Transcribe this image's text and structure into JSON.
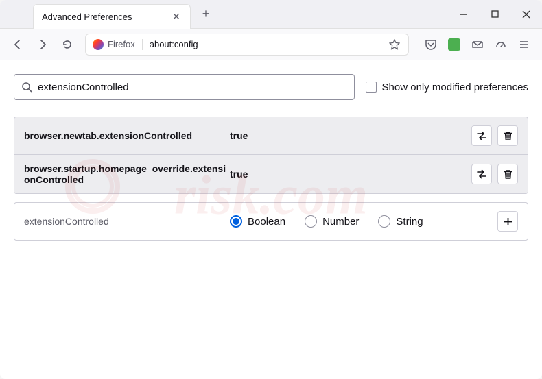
{
  "window": {
    "tab_title": "Advanced Preferences"
  },
  "urlbar": {
    "identity_label": "Firefox",
    "url": "about:config"
  },
  "search": {
    "value": "extensionControlled",
    "checkbox_label": "Show only modified preferences"
  },
  "prefs": [
    {
      "name": "browser.newtab.extensionControlled",
      "value": "true"
    },
    {
      "name": "browser.startup.homepage_override.extensionControlled",
      "value": "true"
    }
  ],
  "new_pref": {
    "name": "extensionControlled",
    "types": [
      "Boolean",
      "Number",
      "String"
    ],
    "selected": "Boolean"
  }
}
